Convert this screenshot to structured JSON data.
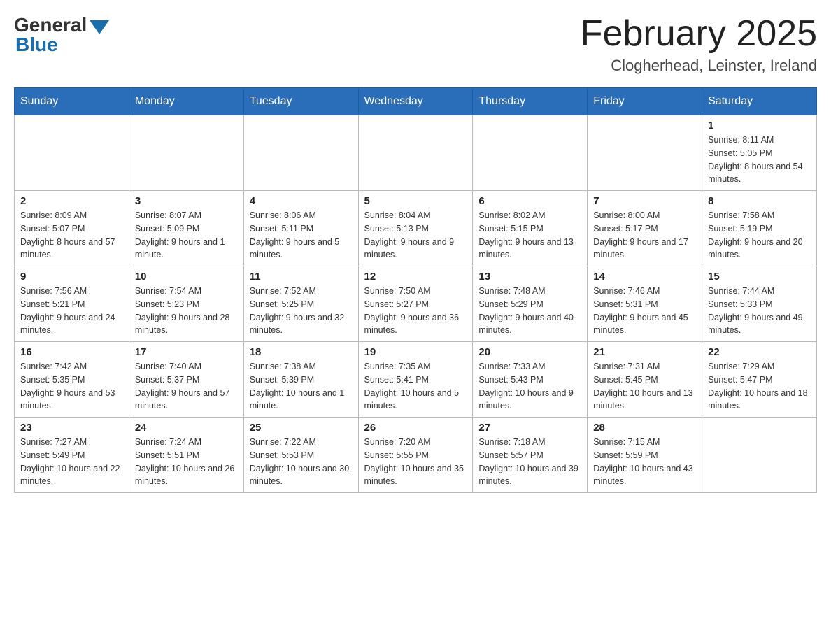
{
  "logo": {
    "general": "General",
    "blue": "Blue"
  },
  "title": {
    "month_year": "February 2025",
    "location": "Clogherhead, Leinster, Ireland"
  },
  "headers": [
    "Sunday",
    "Monday",
    "Tuesday",
    "Wednesday",
    "Thursday",
    "Friday",
    "Saturday"
  ],
  "weeks": [
    [
      {
        "day": "",
        "sunrise": "",
        "sunset": "",
        "daylight": ""
      },
      {
        "day": "",
        "sunrise": "",
        "sunset": "",
        "daylight": ""
      },
      {
        "day": "",
        "sunrise": "",
        "sunset": "",
        "daylight": ""
      },
      {
        "day": "",
        "sunrise": "",
        "sunset": "",
        "daylight": ""
      },
      {
        "day": "",
        "sunrise": "",
        "sunset": "",
        "daylight": ""
      },
      {
        "day": "",
        "sunrise": "",
        "sunset": "",
        "daylight": ""
      },
      {
        "day": "1",
        "sunrise": "Sunrise: 8:11 AM",
        "sunset": "Sunset: 5:05 PM",
        "daylight": "Daylight: 8 hours and 54 minutes."
      }
    ],
    [
      {
        "day": "2",
        "sunrise": "Sunrise: 8:09 AM",
        "sunset": "Sunset: 5:07 PM",
        "daylight": "Daylight: 8 hours and 57 minutes."
      },
      {
        "day": "3",
        "sunrise": "Sunrise: 8:07 AM",
        "sunset": "Sunset: 5:09 PM",
        "daylight": "Daylight: 9 hours and 1 minute."
      },
      {
        "day": "4",
        "sunrise": "Sunrise: 8:06 AM",
        "sunset": "Sunset: 5:11 PM",
        "daylight": "Daylight: 9 hours and 5 minutes."
      },
      {
        "day": "5",
        "sunrise": "Sunrise: 8:04 AM",
        "sunset": "Sunset: 5:13 PM",
        "daylight": "Daylight: 9 hours and 9 minutes."
      },
      {
        "day": "6",
        "sunrise": "Sunrise: 8:02 AM",
        "sunset": "Sunset: 5:15 PM",
        "daylight": "Daylight: 9 hours and 13 minutes."
      },
      {
        "day": "7",
        "sunrise": "Sunrise: 8:00 AM",
        "sunset": "Sunset: 5:17 PM",
        "daylight": "Daylight: 9 hours and 17 minutes."
      },
      {
        "day": "8",
        "sunrise": "Sunrise: 7:58 AM",
        "sunset": "Sunset: 5:19 PM",
        "daylight": "Daylight: 9 hours and 20 minutes."
      }
    ],
    [
      {
        "day": "9",
        "sunrise": "Sunrise: 7:56 AM",
        "sunset": "Sunset: 5:21 PM",
        "daylight": "Daylight: 9 hours and 24 minutes."
      },
      {
        "day": "10",
        "sunrise": "Sunrise: 7:54 AM",
        "sunset": "Sunset: 5:23 PM",
        "daylight": "Daylight: 9 hours and 28 minutes."
      },
      {
        "day": "11",
        "sunrise": "Sunrise: 7:52 AM",
        "sunset": "Sunset: 5:25 PM",
        "daylight": "Daylight: 9 hours and 32 minutes."
      },
      {
        "day": "12",
        "sunrise": "Sunrise: 7:50 AM",
        "sunset": "Sunset: 5:27 PM",
        "daylight": "Daylight: 9 hours and 36 minutes."
      },
      {
        "day": "13",
        "sunrise": "Sunrise: 7:48 AM",
        "sunset": "Sunset: 5:29 PM",
        "daylight": "Daylight: 9 hours and 40 minutes."
      },
      {
        "day": "14",
        "sunrise": "Sunrise: 7:46 AM",
        "sunset": "Sunset: 5:31 PM",
        "daylight": "Daylight: 9 hours and 45 minutes."
      },
      {
        "day": "15",
        "sunrise": "Sunrise: 7:44 AM",
        "sunset": "Sunset: 5:33 PM",
        "daylight": "Daylight: 9 hours and 49 minutes."
      }
    ],
    [
      {
        "day": "16",
        "sunrise": "Sunrise: 7:42 AM",
        "sunset": "Sunset: 5:35 PM",
        "daylight": "Daylight: 9 hours and 53 minutes."
      },
      {
        "day": "17",
        "sunrise": "Sunrise: 7:40 AM",
        "sunset": "Sunset: 5:37 PM",
        "daylight": "Daylight: 9 hours and 57 minutes."
      },
      {
        "day": "18",
        "sunrise": "Sunrise: 7:38 AM",
        "sunset": "Sunset: 5:39 PM",
        "daylight": "Daylight: 10 hours and 1 minute."
      },
      {
        "day": "19",
        "sunrise": "Sunrise: 7:35 AM",
        "sunset": "Sunset: 5:41 PM",
        "daylight": "Daylight: 10 hours and 5 minutes."
      },
      {
        "day": "20",
        "sunrise": "Sunrise: 7:33 AM",
        "sunset": "Sunset: 5:43 PM",
        "daylight": "Daylight: 10 hours and 9 minutes."
      },
      {
        "day": "21",
        "sunrise": "Sunrise: 7:31 AM",
        "sunset": "Sunset: 5:45 PM",
        "daylight": "Daylight: 10 hours and 13 minutes."
      },
      {
        "day": "22",
        "sunrise": "Sunrise: 7:29 AM",
        "sunset": "Sunset: 5:47 PM",
        "daylight": "Daylight: 10 hours and 18 minutes."
      }
    ],
    [
      {
        "day": "23",
        "sunrise": "Sunrise: 7:27 AM",
        "sunset": "Sunset: 5:49 PM",
        "daylight": "Daylight: 10 hours and 22 minutes."
      },
      {
        "day": "24",
        "sunrise": "Sunrise: 7:24 AM",
        "sunset": "Sunset: 5:51 PM",
        "daylight": "Daylight: 10 hours and 26 minutes."
      },
      {
        "day": "25",
        "sunrise": "Sunrise: 7:22 AM",
        "sunset": "Sunset: 5:53 PM",
        "daylight": "Daylight: 10 hours and 30 minutes."
      },
      {
        "day": "26",
        "sunrise": "Sunrise: 7:20 AM",
        "sunset": "Sunset: 5:55 PM",
        "daylight": "Daylight: 10 hours and 35 minutes."
      },
      {
        "day": "27",
        "sunrise": "Sunrise: 7:18 AM",
        "sunset": "Sunset: 5:57 PM",
        "daylight": "Daylight: 10 hours and 39 minutes."
      },
      {
        "day": "28",
        "sunrise": "Sunrise: 7:15 AM",
        "sunset": "Sunset: 5:59 PM",
        "daylight": "Daylight: 10 hours and 43 minutes."
      },
      {
        "day": "",
        "sunrise": "",
        "sunset": "",
        "daylight": ""
      }
    ]
  ]
}
